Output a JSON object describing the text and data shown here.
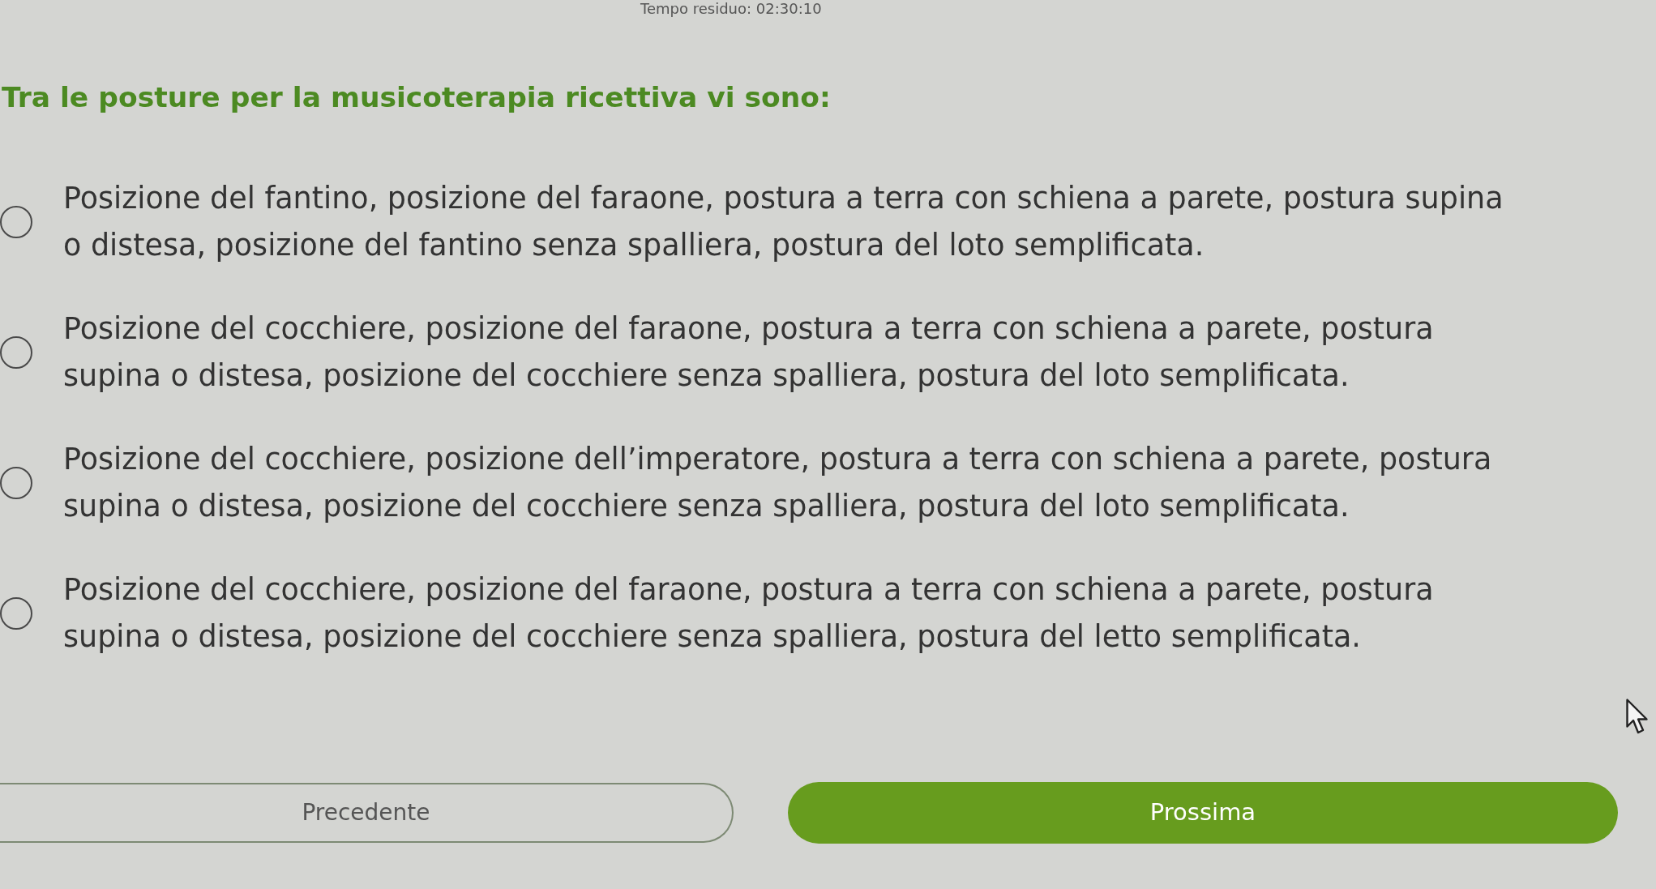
{
  "timer": "Tempo residuo: 02:30:10",
  "question": "Tra le posture per la musicoterapia ricettiva vi sono:",
  "options": [
    {
      "text": "Posizione del fantino, posizione del faraone, postura a terra con schiena a parete, postura supina o distesa, posizione del fantino senza spalliera, postura del loto semplificata.",
      "selected": false
    },
    {
      "text": "Posizione del cocchiere, posizione del faraone, postura a terra con schiena a parete, postura supina o distesa, posizione del cocchiere senza spalliera, postura del loto semplificata.",
      "selected": false
    },
    {
      "text": "Posizione del cocchiere, posizione dell’imperatore, postura a terra con schiena a parete, postura supina o distesa, posizione del cocchiere senza spalliera, postura del loto semplificata.",
      "selected": false
    },
    {
      "text": "Posizione del cocchiere, posizione del faraone, postura a terra con schiena a parete, postura supina o distesa, posizione del cocchiere senza spalliera, postura del letto semplificata.",
      "selected": false
    }
  ],
  "buttons": [
    {
      "label": "Precedente",
      "kind": "secondary"
    },
    {
      "label": "Prossima",
      "kind": "primary"
    }
  ]
}
